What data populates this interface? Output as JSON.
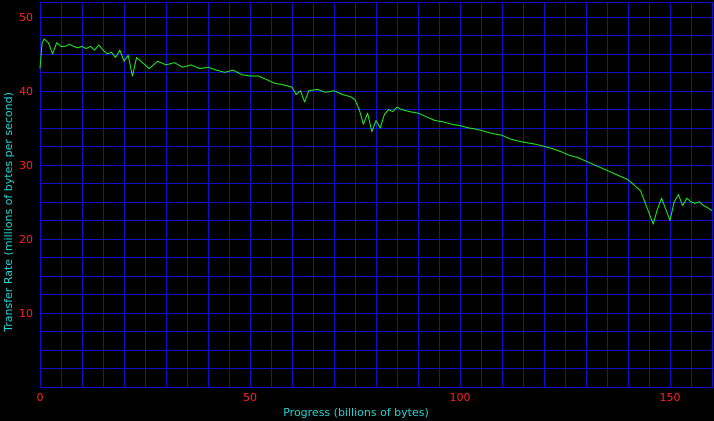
{
  "chart_data": {
    "type": "line",
    "xlabel": "Progress (billions of bytes)",
    "ylabel": "Transfer Rate (millions of bytes per second)",
    "xlim": [
      0,
      160
    ],
    "ylim": [
      0,
      52
    ],
    "x_ticks": [
      0,
      50,
      100,
      150
    ],
    "y_ticks": [
      10,
      20,
      30,
      40,
      50
    ],
    "grid": true,
    "colors": {
      "background": "#000000",
      "grid": "#1010c8",
      "line": "#22ee22",
      "tick_labels": "#ff2020",
      "axis_titles": "#22d3d3"
    },
    "series": [
      {
        "x": [
          0,
          0.5,
          1,
          2,
          3,
          4,
          5,
          6,
          7,
          8,
          9,
          10,
          11,
          12,
          13,
          14,
          15,
          16,
          17,
          18,
          19,
          20,
          21,
          22,
          23,
          24,
          25,
          26,
          28,
          30,
          32,
          34,
          36,
          38,
          40,
          42,
          44,
          46,
          48,
          50,
          52,
          54,
          56,
          58,
          60,
          61,
          62,
          63,
          64,
          66,
          68,
          70,
          72,
          74,
          75,
          76,
          77,
          78,
          79,
          80,
          81,
          82,
          83,
          84,
          85,
          86,
          88,
          90,
          92,
          94,
          96,
          98,
          100,
          102,
          104,
          106,
          108,
          110,
          112,
          114,
          116,
          118,
          120,
          122,
          124,
          126,
          128,
          130,
          132,
          134,
          136,
          138,
          140,
          141,
          142,
          143,
          144,
          145,
          146,
          147,
          148,
          149,
          150,
          151,
          152,
          153,
          154,
          155,
          156,
          157,
          158,
          159,
          160
        ],
        "y": [
          43,
          46.5,
          47,
          46.5,
          45,
          46.5,
          46,
          46,
          46.3,
          46,
          45.8,
          46,
          45.7,
          46,
          45.5,
          46.2,
          45.5,
          45,
          45.2,
          44.5,
          45.5,
          44,
          44.8,
          42,
          44.5,
          44,
          43.5,
          43,
          44,
          43.5,
          43.8,
          43.2,
          43.5,
          43,
          43.2,
          42.8,
          42.5,
          42.8,
          42.2,
          42,
          42,
          41.5,
          41,
          40.8,
          40.5,
          39.5,
          40,
          38.5,
          40,
          40.2,
          39.8,
          40,
          39.5,
          39.2,
          38.8,
          37.5,
          35.5,
          37,
          34.5,
          36,
          35,
          36.8,
          37.5,
          37.2,
          37.8,
          37.5,
          37.2,
          37,
          36.5,
          36,
          35.8,
          35.5,
          35.3,
          35,
          34.8,
          34.5,
          34.2,
          34,
          33.5,
          33.2,
          33,
          32.8,
          32.5,
          32.2,
          31.8,
          31.3,
          31,
          30.5,
          30,
          29.5,
          29,
          28.5,
          28,
          27.5,
          27,
          26.5,
          25,
          23.5,
          22,
          24,
          25.5,
          24,
          22.5,
          25,
          26,
          24.5,
          25.5,
          25,
          24.8,
          25,
          24.5,
          24.2,
          23.8
        ]
      }
    ]
  }
}
